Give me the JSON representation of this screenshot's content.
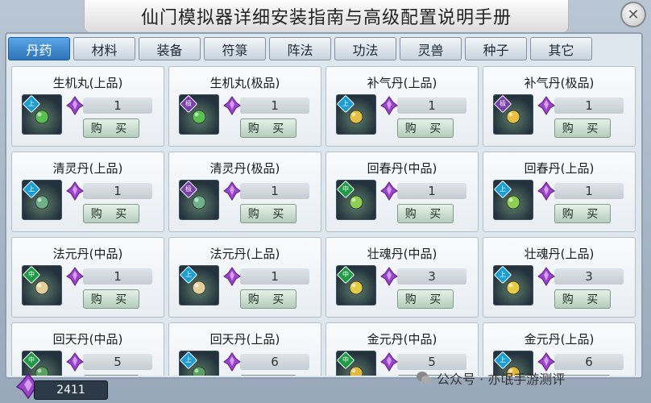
{
  "title": "仙门模拟器详细安装指南与高级配置说明手册",
  "close_label": "✕",
  "tabs": [
    {
      "label": "丹药",
      "active": true
    },
    {
      "label": "材料",
      "active": false
    },
    {
      "label": "装备",
      "active": false
    },
    {
      "label": "符箓",
      "active": false
    },
    {
      "label": "阵法",
      "active": false
    },
    {
      "label": "功法",
      "active": false
    },
    {
      "label": "灵兽",
      "active": false
    },
    {
      "label": "种子",
      "active": false
    },
    {
      "label": "其它",
      "active": false
    }
  ],
  "buy_label": "购 买",
  "items": [
    {
      "name": "生机丸(上品)",
      "price": "1",
      "grade_icon": "grade-top-icon",
      "grade_char": "上",
      "color": "#58c050"
    },
    {
      "name": "生机丸(极品)",
      "price": "1",
      "grade_icon": "grade-best-icon",
      "grade_char": "极",
      "color": "#58c050"
    },
    {
      "name": "补气丹(上品)",
      "price": "1",
      "grade_icon": "grade-top-icon",
      "grade_char": "上",
      "color": "#e6c040"
    },
    {
      "name": "补气丹(极品)",
      "price": "1",
      "grade_icon": "grade-best-icon",
      "grade_char": "极",
      "color": "#e6c040"
    },
    {
      "name": "清灵丹(上品)",
      "price": "1",
      "grade_icon": "grade-top-icon",
      "grade_char": "上",
      "color": "#6fb08a"
    },
    {
      "name": "清灵丹(极品)",
      "price": "1",
      "grade_icon": "grade-best-icon",
      "grade_char": "极",
      "color": "#6fb08a"
    },
    {
      "name": "回春丹(中品)",
      "price": "1",
      "grade_icon": "grade-mid-icon",
      "grade_char": "中",
      "color": "#8ccf52"
    },
    {
      "name": "回春丹(上品)",
      "price": "1",
      "grade_icon": "grade-top-icon",
      "grade_char": "上",
      "color": "#8ccf52"
    },
    {
      "name": "法元丹(中品)",
      "price": "1",
      "grade_icon": "grade-mid-icon",
      "grade_char": "中",
      "color": "#e2cf9a"
    },
    {
      "name": "法元丹(上品)",
      "price": "1",
      "grade_icon": "grade-top-icon",
      "grade_char": "上",
      "color": "#e2cf9a"
    },
    {
      "name": "壮魂丹(中品)",
      "price": "3",
      "grade_icon": "grade-mid-icon",
      "grade_char": "中",
      "color": "#e5cc44"
    },
    {
      "name": "壮魂丹(上品)",
      "price": "3",
      "grade_icon": "grade-top-icon",
      "grade_char": "上",
      "color": "#e5cc44"
    },
    {
      "name": "回天丹(中品)",
      "price": "5",
      "grade_icon": "grade-mid-icon",
      "grade_char": "中",
      "color": "#5aa060"
    },
    {
      "name": "回天丹(上品)",
      "price": "6",
      "grade_icon": "grade-top-icon",
      "grade_char": "上",
      "color": "#5aa060"
    },
    {
      "name": "金元丹(中品)",
      "price": "5",
      "grade_icon": "grade-mid-icon",
      "grade_char": "中",
      "color": "#e0b840"
    },
    {
      "name": "金元丹(上品)",
      "price": "6",
      "grade_icon": "grade-top-icon",
      "grade_char": "上",
      "color": "#e0b840"
    }
  ],
  "currency": {
    "icon": "spirit-stone-icon",
    "amount": "2411"
  },
  "watermark": {
    "icon": "wechat-icon",
    "text": "公众号 · 亦氓手游测评"
  }
}
